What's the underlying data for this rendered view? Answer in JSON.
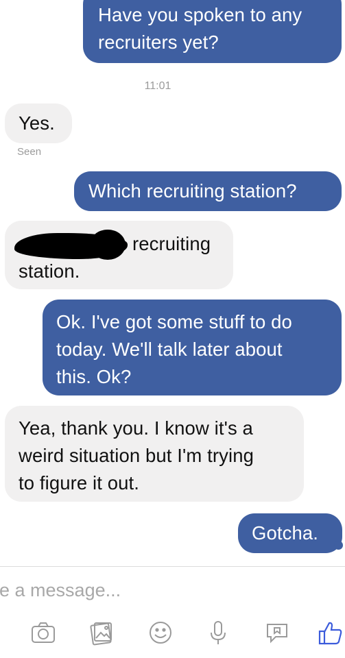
{
  "conversation": {
    "timestamp": "11:01",
    "seen": "Seen",
    "messages": [
      {
        "direction": "outgoing",
        "text": "Have you spoken to any\nrecruiters yet?"
      },
      {
        "direction": "incoming",
        "text": "Yes."
      },
      {
        "direction": "outgoing",
        "text": "Which recruiting station?"
      },
      {
        "direction": "incoming",
        "text_line1": "recruiting",
        "text_line2": "station.",
        "redacted": true
      },
      {
        "direction": "outgoing",
        "text": "Ok. I've got some stuff to do\ntoday. We'll talk later about\nthis. Ok?"
      },
      {
        "direction": "incoming",
        "text": "Yea, thank you. I know it's a\nweird situation but I'm trying\nto figure it out."
      },
      {
        "direction": "outgoing",
        "text": "Gotcha."
      }
    ]
  },
  "composer": {
    "placeholder": "pe a message...",
    "tools": [
      "camera-icon",
      "gallery-icon",
      "emoji-icon",
      "microphone-icon",
      "sticker-icon",
      "like-icon"
    ]
  },
  "colors": {
    "outgoing_bubble": "#3f5fa1",
    "incoming_bubble": "#f1f0f0",
    "accent": "#3b5bdb"
  }
}
